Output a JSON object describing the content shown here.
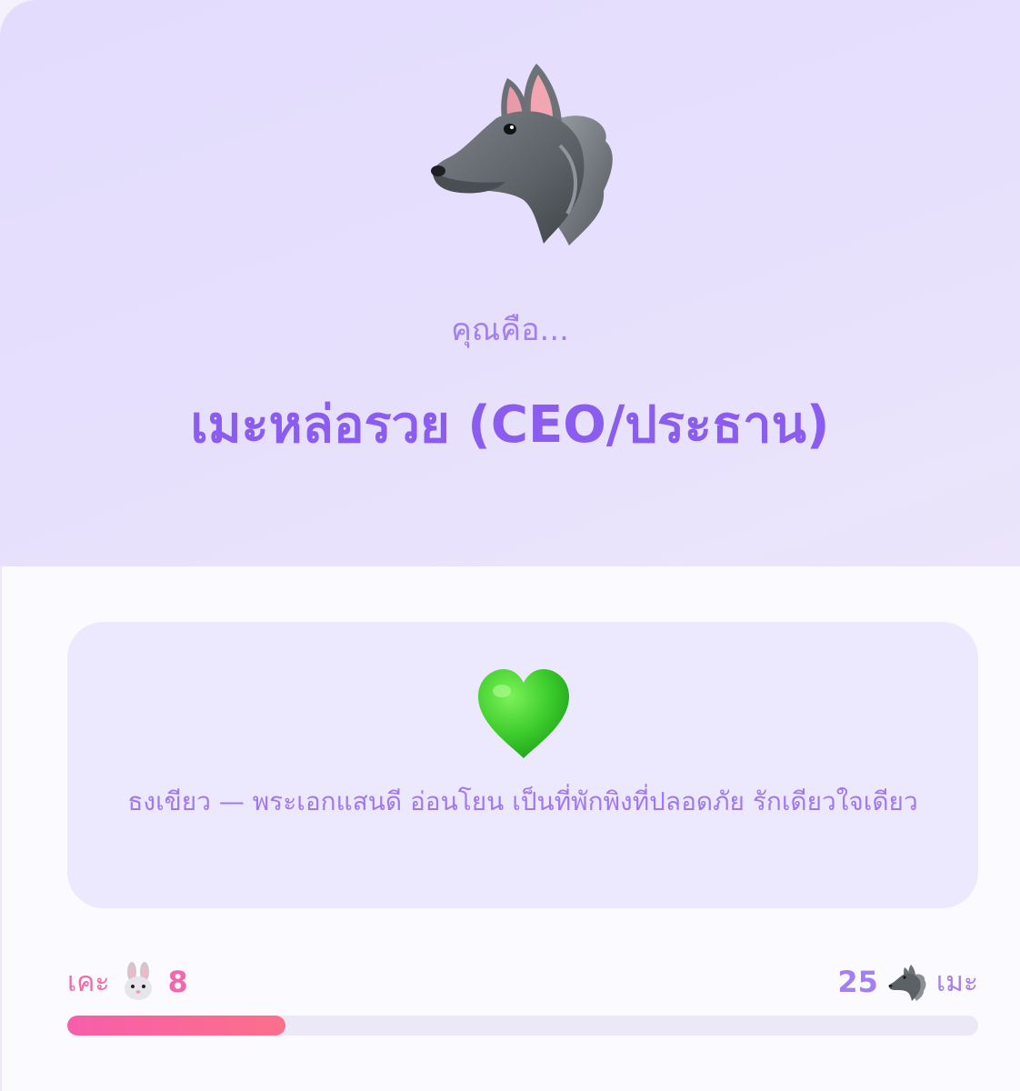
{
  "hero": {
    "icon": "wolf-icon",
    "pre_title": "คุณคือ...",
    "title": "เมะหล่อรวย (CEO/ประธาน)"
  },
  "description": {
    "icon": "green-heart-icon",
    "text": "ธงเขียว — พระเอกแสนดี อ่อนโยน เป็นที่พักพิงที่ปลอดภัย รักเดียวใจเดียว"
  },
  "score": {
    "left_label": "เคะ",
    "left_icon": "rabbit-icon",
    "left_value": "8",
    "right_value": "25",
    "right_icon": "wolf-icon",
    "right_label": "เมะ",
    "left_share": 0.24
  },
  "colors": {
    "accent_purple": "#8b5cf0",
    "accent_pink": "#f567ac",
    "hero_bg": "#e3dcfd",
    "box_bg": "#ece8fd"
  }
}
